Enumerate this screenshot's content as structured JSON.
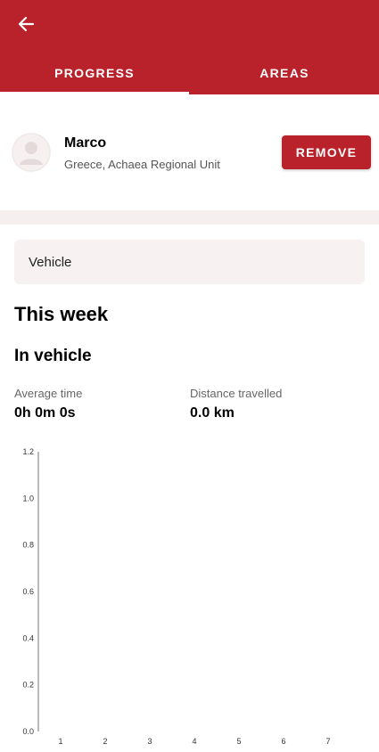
{
  "appbar": {
    "back_icon": "arrow-left-icon"
  },
  "tabs": [
    {
      "label": "PROGRESS",
      "selected": true
    },
    {
      "label": "AREAS",
      "selected": false
    }
  ],
  "profile": {
    "name": "Marco",
    "location": "Greece, Achaea Regional Unit",
    "avatar_icon": "person-placeholder-icon",
    "remove_label": "REMOVE"
  },
  "selector": {
    "value": "Vehicle"
  },
  "section": {
    "title": "This week",
    "subtitle": "In vehicle"
  },
  "stats": {
    "avg_time_label": "Average time",
    "avg_time_value": "0h 0m 0s",
    "distance_label": "Distance travelled",
    "distance_value": "0.0 km"
  },
  "colors": {
    "primary": "#b9222b",
    "surface": "#f7f1f1"
  },
  "chart_data": {
    "type": "bar",
    "categories": [
      "1",
      "2",
      "3",
      "4",
      "5",
      "6",
      "7"
    ],
    "values": [
      0,
      0,
      0,
      0,
      0,
      0,
      0
    ],
    "ylim": [
      0,
      1.2
    ],
    "yticks": [
      "0.0",
      "0.2",
      "0.4",
      "0.6",
      "0.8",
      "1.0",
      "1.2"
    ],
    "grid": false
  }
}
